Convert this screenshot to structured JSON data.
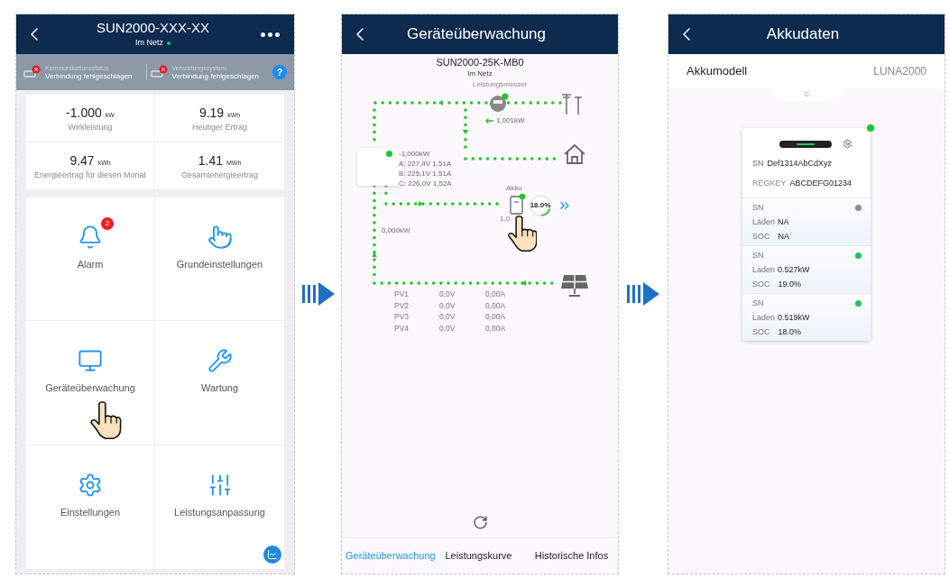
{
  "home_screen": {
    "title": "SUN2000-XXX-XX",
    "status": "Im Netz",
    "online": true,
    "status_bar": [
      {
        "label": "Kommunikationsstatus",
        "value": "Verbindung fehlgeschlagen",
        "error": true
      },
      {
        "label": "Verwaltungssystem",
        "value": "Verbindung fehlgeschlagen",
        "error": true
      }
    ],
    "help": "?",
    "metrics": [
      {
        "value": "-1.000",
        "unit": "kW",
        "label": "Wirkleistung"
      },
      {
        "value": "9.19",
        "unit": "kWh",
        "label": "Heutiger Ertrag"
      },
      {
        "value": "9.47",
        "unit": "kWh",
        "label": "Energieertrag für diesen Monat"
      },
      {
        "value": "1.41",
        "unit": "MWh",
        "label": "Gesamtenergieertrag"
      }
    ],
    "tiles": [
      {
        "kind": "alarm",
        "label": "Alarm",
        "badge": "2"
      },
      {
        "kind": "basic",
        "label": "Grundeinstellungen"
      },
      {
        "kind": "monitor",
        "label": "Geräteüberwachung",
        "pointer": true
      },
      {
        "kind": "maintenance",
        "label": "Wartung"
      },
      {
        "kind": "settings",
        "label": "Einstellungen"
      },
      {
        "kind": "power",
        "label": "Leistungsanpassung"
      }
    ]
  },
  "monitoring_screen": {
    "title": "Geräteüberwachung",
    "model": "SUN2000-25K-MB0",
    "status": "Im Netz",
    "meter_label": "Leistungsmesser",
    "grid_flow": "1,001kW",
    "inverter_readings": [
      "-1,000kW",
      "A: 227,4V 1,51A",
      "B: 225,1V 1,51A",
      "C: 226,0V 1,52A"
    ],
    "battery_label": "Akku",
    "battery_soc": "18.0%",
    "level": 0.18,
    "battery_power": "1,0",
    "pv_flow": "0,000kW",
    "pv_rows": [
      [
        "PV1",
        "0,0V",
        "0,00A"
      ],
      [
        "PV2",
        "0,0V",
        "0,00A"
      ],
      [
        "PV3",
        "0,0V",
        "0,00A"
      ],
      [
        "PV4",
        "0,0V",
        "0,00A"
      ]
    ],
    "tabs": [
      {
        "label": "Geräteüberwachung",
        "selected": true
      },
      {
        "label": "Leistungskurve",
        "selected": false
      },
      {
        "label": "Historische Infos",
        "selected": false
      }
    ]
  },
  "battery_screen": {
    "title": "Akkudaten",
    "model_label": "Akkumodell",
    "model_value": "LUNA2000",
    "online": true,
    "sn_label": "SN",
    "sn": "Def1314AbCdXyz",
    "regkey_label": "REGKEY",
    "regkey": "ABCDEFG01234",
    "modules": [
      {
        "sn_label": "SN",
        "color": "#8c8c8c",
        "charge_label": "Laden",
        "charge": "NA",
        "soc_label": "SOC",
        "soc": "NA"
      },
      {
        "sn_label": "SN",
        "color": "#22c55e",
        "charge_label": "Laden",
        "charge": "0.527kW",
        "soc_label": "SOC",
        "soc": "19.0%"
      },
      {
        "sn_label": "SN",
        "color": "#22c55e",
        "charge_label": "Laden",
        "charge": "0.519kW",
        "soc_label": "SOC",
        "soc": "18.0%"
      }
    ]
  }
}
